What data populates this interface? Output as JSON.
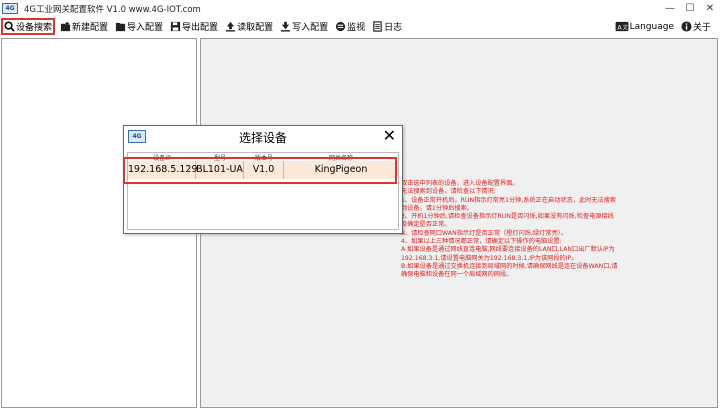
{
  "window": {
    "title": "4G工业网关配置软件 V1.0  www.4G-IOT.com",
    "icon_text": "4G",
    "min_glyph": "—",
    "max_glyph": "☐",
    "close_glyph": "✕"
  },
  "toolbar": {
    "items": [
      {
        "label": "设备搜索",
        "icon": "search-icon"
      },
      {
        "label": "新建配置",
        "icon": "new-folder-icon"
      },
      {
        "label": "导入配置",
        "icon": "import-folder-icon"
      },
      {
        "label": "导出配置",
        "icon": "save-icon"
      },
      {
        "label": "读取配置",
        "icon": "upload-arrow-icon"
      },
      {
        "label": "写入配置",
        "icon": "download-arrow-icon"
      },
      {
        "label": "监视",
        "icon": "monitor-icon"
      },
      {
        "label": "日志",
        "icon": "log-icon"
      }
    ],
    "language_label": "Language",
    "about_label": "关于"
  },
  "dialog": {
    "title": "选择设备",
    "close_glyph": "✕",
    "columns": [
      "设备IP",
      "型号",
      "版本号",
      "网关名称"
    ],
    "rows": [
      {
        "ip": "192.168.5.129",
        "model": "BL101-UA",
        "version": "V1.0",
        "name": "KingPigeon"
      }
    ]
  },
  "notes": [
    "双击选中列表的设备，进入设备配置界面。",
    "无法搜索到设备，请检查以下情况:",
    "1、设备正常开机后，RUN指示灯常亮1分钟,系统正在启动状态，此时无法搜索到设备，请1分钟后搜索。",
    "2、开机1分钟后,请检查设备指示灯RUN是否闪烁,如果没有闪烁,检查电源接线及确定是否正常。",
    "3、请检查网口WAN指示灯是否正常（橙灯闪烁,绿灯常亮）。",
    "4、如果以上三种情况都正常，请确定以下操作的电脑设置:",
    "  A.如果设备是通过网线直连电脑,网线要连接设备的LAN口,LAN口出厂默认IP为192.168.3.1,请设置电脑网关为192.168.3.1,IP为该网段的IP。",
    "  B.如果设备是通过交换机连接到局域网的时候,请确保网线是连在设备WAN口,请确保电脑和设备在同一个局域网的网段。"
  ],
  "colors": {
    "highlight_border": "#e0322e",
    "notes_text": "#e02020",
    "selected_row": "#fde9d9"
  }
}
